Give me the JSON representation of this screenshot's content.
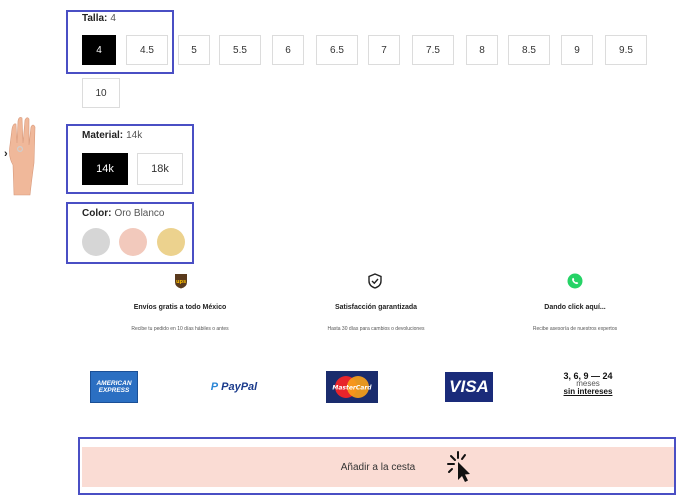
{
  "talla": {
    "label": "Talla:",
    "value": "4",
    "options": [
      "4",
      "4.5",
      "5",
      "5.5",
      "6",
      "6.5",
      "7",
      "7.5",
      "8",
      "8.5",
      "9",
      "9.5",
      "10"
    ],
    "selected": "4"
  },
  "material": {
    "label": "Material:",
    "value": "14k",
    "options": [
      "14k",
      "18k"
    ],
    "selected": "14k"
  },
  "color": {
    "label": "Color:",
    "value": "Oro Blanco",
    "swatches": [
      {
        "name": "oro-blanco",
        "hex": "#d6d6d6"
      },
      {
        "name": "oro-rosa",
        "hex": "#f2c9bc"
      },
      {
        "name": "oro-amarillo",
        "hex": "#ecd28e"
      }
    ]
  },
  "features": [
    {
      "icon": "ups-icon",
      "title": "Envíos gratis a todo México",
      "subtitle": "Recibe tu pedido en 10 días hábiles o antes"
    },
    {
      "icon": "shield-check-icon",
      "title": "Satisfacción garantizada",
      "subtitle": "Hasta 30 días para cambios o devoluciones"
    },
    {
      "icon": "whatsapp-icon",
      "title": "Dando click aquí...",
      "subtitle": "Recibe asesoría de nuestros expertos"
    }
  ],
  "payments": {
    "amex_line1": "AMERICAN",
    "amex_line2": "EXPRESS",
    "paypal": "PayPal",
    "mastercard": "MasterCard",
    "visa": "VISA",
    "meses_numbers": "3, 6, 9 — 24",
    "meses_label": "meses",
    "meses_sub": "sin intereses"
  },
  "cart": {
    "label": "Añadir a la cesta"
  },
  "colors": {
    "highlight": "#4a4fc4",
    "cart_bg": "#fadcd4",
    "selected_bg": "#000000"
  }
}
